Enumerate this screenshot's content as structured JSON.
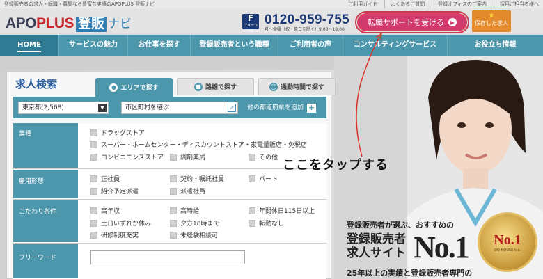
{
  "topbar": {
    "tagline": "登録販売者の求人・転職・募集なら豊富な実績のAPOPLUS 登販ナビ",
    "links": [
      "ご利用ガイド",
      "よくあるご質問",
      "登録オフィスのご案内",
      "採用ご担当者様へ"
    ]
  },
  "header": {
    "logo": {
      "apo": "APO",
      "plus": "PLUS",
      "touhan": "登販",
      "navi": "ナビ"
    },
    "phone": {
      "freedial_label": "フリーコール",
      "number": "0120-959-755",
      "hours": "月〜金曜（祝・祭日を除く）9:00〜18:00"
    },
    "support_button": "転職サポートを受ける",
    "saved_button": "保存した求人",
    "colors": {
      "support": "#d33a6e",
      "saved": "#e38a2c",
      "brand_blue": "#2f7fb4"
    }
  },
  "nav": {
    "items": [
      "HOME",
      "サービスの魅力",
      "お仕事を探す",
      "登録販売者という職種",
      "ご利用者の声",
      "コンサルティングサービス",
      "お役立ち情報"
    ],
    "active_color": "#2f7b93",
    "bar_color": "#4d97ad"
  },
  "search": {
    "title": "求人検索",
    "tabs": [
      {
        "label": "エリアで探す",
        "icon": "map-pin-icon",
        "active": true
      },
      {
        "label": "路線で探す",
        "icon": "train-icon",
        "active": false
      },
      {
        "label": "通勤時間で探す",
        "icon": "clock-icon",
        "active": false
      }
    ],
    "prefecture": "東京都(2,568)",
    "city_placeholder": "市区町村を選ぶ",
    "other_prefectures": "他の都道府県を追加",
    "sections": [
      {
        "label": "業種",
        "options": [
          "ドラッグストア",
          "スーパー・ホームセンター・ディスカウントストア・家電量販店・免税店",
          "コンビニエンスストア",
          "調剤薬局",
          "その他"
        ]
      },
      {
        "label": "雇用形態",
        "options": [
          "正社員",
          "契約・嘱託社員",
          "パート",
          "紹介予定派遣",
          "派遣社員"
        ]
      },
      {
        "label": "こだわり条件",
        "options": [
          "高年収",
          "高時給",
          "年間休日115日以上",
          "土日いずれか休み",
          "夕方18時まで",
          "転勤なし",
          "研修制度充実",
          "未経験相談可"
        ]
      },
      {
        "label": "フリーワード",
        "options": []
      }
    ]
  },
  "annotation": {
    "callout": "ここをタップする"
  },
  "hero": {
    "line1": "登録販売者が選ぶ、おすすめの",
    "line2": "登録販売者",
    "line3": "求人サイト",
    "no1": "No.1",
    "line4": "25年以上の実績と登録販売者専門の",
    "medal_no1": "No.1",
    "medal_sub": "DO HOUSE Inc."
  }
}
